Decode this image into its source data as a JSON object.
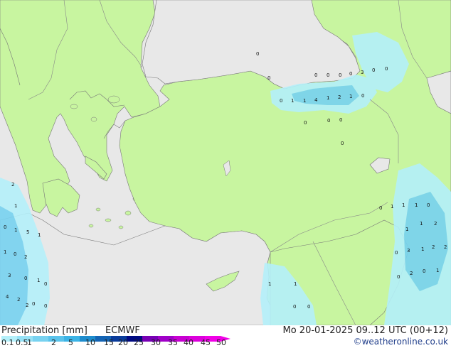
{
  "legend": {
    "title": "Precipitation [mm]",
    "model": "ECMWF",
    "datetime": "Mo 20-01-2025 09..12 UTC (00+12)",
    "credit": "©weatheronline.co.uk",
    "scale_values": [
      "0.1",
      "0.5",
      "1",
      "2",
      "5",
      "10",
      "15",
      "20",
      "25",
      "30",
      "35",
      "40",
      "45",
      "50"
    ],
    "scale_colors": [
      "#b4f0fa",
      "#96e1f5",
      "#78d2f0",
      "#5ac3eb",
      "#3cb4e6",
      "#1e8ccd",
      "#1464b4",
      "#0a3c9b",
      "#000a82",
      "#7800b4",
      "#a000c8",
      "#c800d2",
      "#dc00dc",
      "#f000e6"
    ]
  },
  "map": {
    "land_color": "#c8f5a0",
    "sea_color": "#e8e8e8",
    "precip_labels": [
      {
        "t": "0"
      },
      {
        "t": "0"
      },
      {
        "t": "0"
      },
      {
        "t": "0"
      },
      {
        "t": "0"
      },
      {
        "t": "0"
      },
      {
        "t": "3"
      },
      {
        "t": "0"
      },
      {
        "t": "0"
      },
      {
        "t": "0"
      },
      {
        "t": "1"
      },
      {
        "t": "1"
      },
      {
        "t": "4"
      },
      {
        "t": "1"
      },
      {
        "t": "2"
      },
      {
        "t": "1"
      },
      {
        "t": "0"
      },
      {
        "t": "0"
      },
      {
        "t": "0"
      },
      {
        "t": "0"
      },
      {
        "t": "0"
      },
      {
        "t": "0"
      },
      {
        "t": "1"
      },
      {
        "t": "1"
      },
      {
        "t": "1"
      },
      {
        "t": "0"
      },
      {
        "t": "1"
      },
      {
        "t": "1"
      },
      {
        "t": "2"
      },
      {
        "t": "0"
      },
      {
        "t": "3"
      },
      {
        "t": "1"
      },
      {
        "t": "2"
      },
      {
        "t": "2"
      },
      {
        "t": "0"
      },
      {
        "t": "2"
      },
      {
        "t": "0"
      },
      {
        "t": "1"
      },
      {
        "t": "0"
      },
      {
        "t": "1"
      },
      {
        "t": "5"
      },
      {
        "t": "1"
      },
      {
        "t": "1"
      },
      {
        "t": "0"
      },
      {
        "t": "2"
      },
      {
        "t": "3"
      },
      {
        "t": "0"
      },
      {
        "t": "1"
      },
      {
        "t": "4"
      },
      {
        "t": "2"
      },
      {
        "t": "0"
      },
      {
        "t": "2"
      },
      {
        "t": "1"
      },
      {
        "t": "2"
      },
      {
        "t": "0"
      },
      {
        "t": "1"
      },
      {
        "t": "1"
      },
      {
        "t": "0"
      },
      {
        "t": "0"
      },
      {
        "t": "0"
      }
    ]
  }
}
